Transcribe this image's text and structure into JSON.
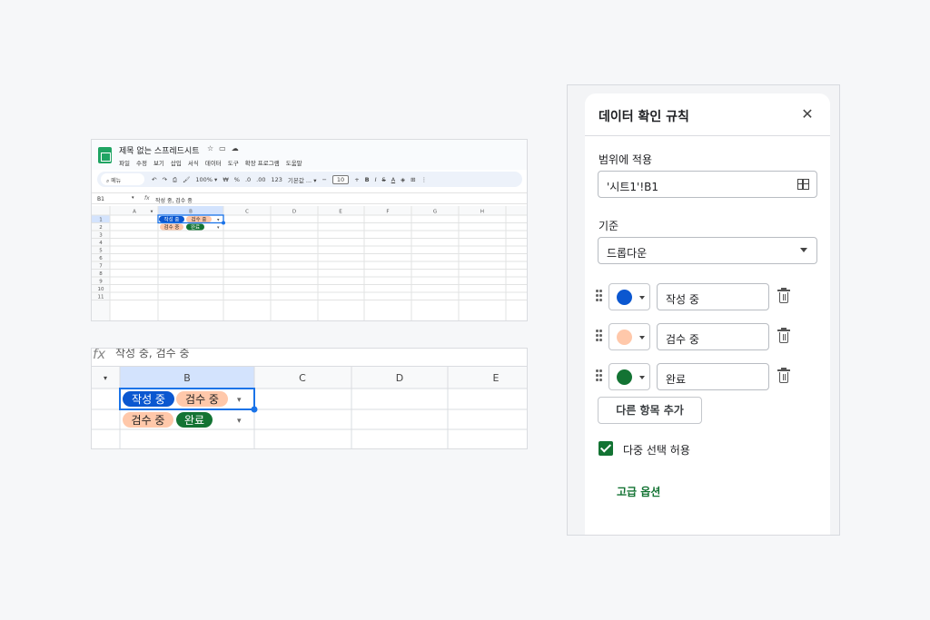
{
  "sheet_small": {
    "doc_title": "제목 없는 스프레드시트",
    "title_icons": [
      "star-icon",
      "folder-icon",
      "cloud-icon"
    ],
    "menu": [
      "파일",
      "수정",
      "보기",
      "삽입",
      "서식",
      "데이터",
      "도구",
      "확장 프로그램",
      "도움말"
    ],
    "search_label": "메뉴",
    "toolbar": {
      "undo": "↶",
      "redo": "↷",
      "print": "⎙",
      "paint": "🖌",
      "zoom": "100%",
      "zoom_caret": "▾",
      "currency": "₩",
      "percent": "%",
      "dec_minus": ".0",
      "dec_plus": ".00",
      "num": "123",
      "font": "기본값 ...",
      "font_caret": "▾",
      "minus": "−",
      "font_size": "10",
      "plus": "+",
      "bold": "B",
      "italic": "I",
      "strike": "S",
      "text_color": "A",
      "fill": "◈",
      "borders": "⊞",
      "more": "⋮"
    },
    "name_box": "B1",
    "name_caret": "▾",
    "fx": "fx",
    "formula": "작성 중, 검수 중",
    "columns": [
      "A",
      "B",
      "C",
      "D",
      "E",
      "F",
      "G",
      "H"
    ],
    "corner_caret": "▾",
    "rows": [
      "1",
      "2",
      "3",
      "4",
      "5",
      "6",
      "7",
      "8",
      "9",
      "10",
      "11"
    ]
  },
  "sheet_big": {
    "fx": "fx",
    "formula": "작성 중, 검수 중",
    "corner_caret": "▾",
    "columns": [
      "B",
      "C",
      "D",
      "E"
    ]
  },
  "cells": {
    "row1": [
      "작성 중",
      "검수 중"
    ],
    "row2": [
      "검수 중",
      "완료"
    ],
    "caret": "▾"
  },
  "panel": {
    "title": "데이터 확인 규칙",
    "close": "✕",
    "range_label": "범위에 적용",
    "range_value": "'시트1'!B1",
    "criteria_label": "기준",
    "criteria_value": "드롭다운",
    "options": [
      {
        "label": "작성 중",
        "color": "#0b57d0"
      },
      {
        "label": "검수 중",
        "color": "#ffc8aa"
      },
      {
        "label": "완료",
        "color": "#137333"
      }
    ],
    "add_button": "다른 항목 추가",
    "multi_select_label": "다중 선택 허용",
    "multi_select_checked": true,
    "advanced_link": "고급 옵션"
  },
  "colors": {
    "accent_green": "#137333",
    "selection_blue": "#1a73e8",
    "chip_blue": "#0b57d0",
    "chip_peach": "#ffc8aa"
  }
}
